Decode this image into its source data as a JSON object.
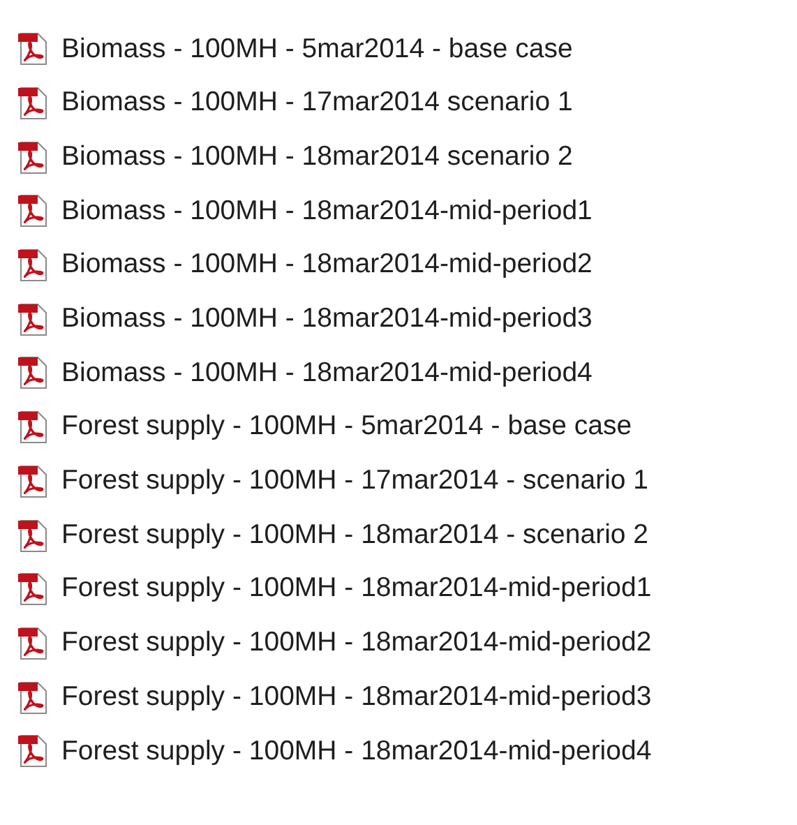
{
  "files": [
    {
      "name": "Biomass - 100MH - 5mar2014 - base case"
    },
    {
      "name": "Biomass - 100MH - 17mar2014 scenario 1"
    },
    {
      "name": "Biomass - 100MH - 18mar2014 scenario 2"
    },
    {
      "name": "Biomass - 100MH - 18mar2014-mid-period1"
    },
    {
      "name": "Biomass - 100MH - 18mar2014-mid-period2"
    },
    {
      "name": "Biomass - 100MH - 18mar2014-mid-period3"
    },
    {
      "name": "Biomass - 100MH - 18mar2014-mid-period4"
    },
    {
      "name": "Forest supply - 100MH - 5mar2014 - base case"
    },
    {
      "name": "Forest supply - 100MH - 17mar2014 - scenario 1"
    },
    {
      "name": "Forest supply - 100MH - 18mar2014 - scenario 2"
    },
    {
      "name": "Forest supply - 100MH - 18mar2014-mid-period1"
    },
    {
      "name": "Forest supply - 100MH - 18mar2014-mid-period2"
    },
    {
      "name": "Forest supply - 100MH - 18mar2014-mid-period3"
    },
    {
      "name": "Forest supply - 100MH - 18mar2014-mid-period4"
    }
  ]
}
